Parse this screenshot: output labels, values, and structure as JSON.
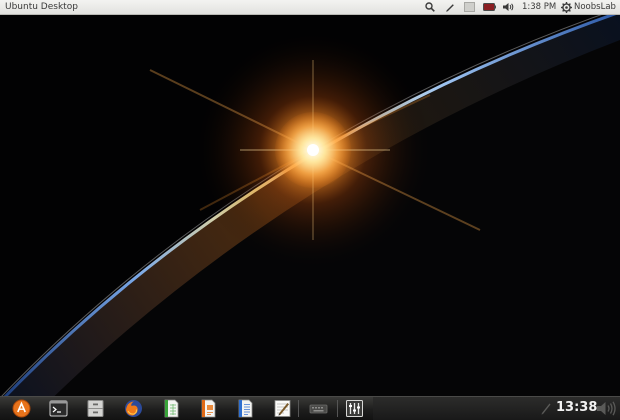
{
  "top_panel": {
    "title": "Ubuntu Desktop",
    "clock": "1:38 PM",
    "session_name": "NoobsLab",
    "indicators": [
      "search-icon",
      "pen-icon",
      "window-icon",
      "battery-icon",
      "volume-icon"
    ]
  },
  "dock": {
    "launchers": [
      "ubuntu-software-center-icon",
      "terminal-icon",
      "file-manager-icon",
      "firefox-icon",
      "spreadsheet-icon",
      "presentation-icon",
      "writer-icon",
      "text-editor-icon",
      "keyboard-icon",
      "mixer-settings-icon"
    ],
    "clock": "13:38",
    "tray_icons": [
      "pen-icon",
      "volume-icon"
    ]
  },
  "colors": {
    "top_panel_bg": "#e8e8e5",
    "dock_bg": "#1e1e1d",
    "sunlight": "#ff8a1e",
    "horizon_blue": "#5b8fd6"
  }
}
